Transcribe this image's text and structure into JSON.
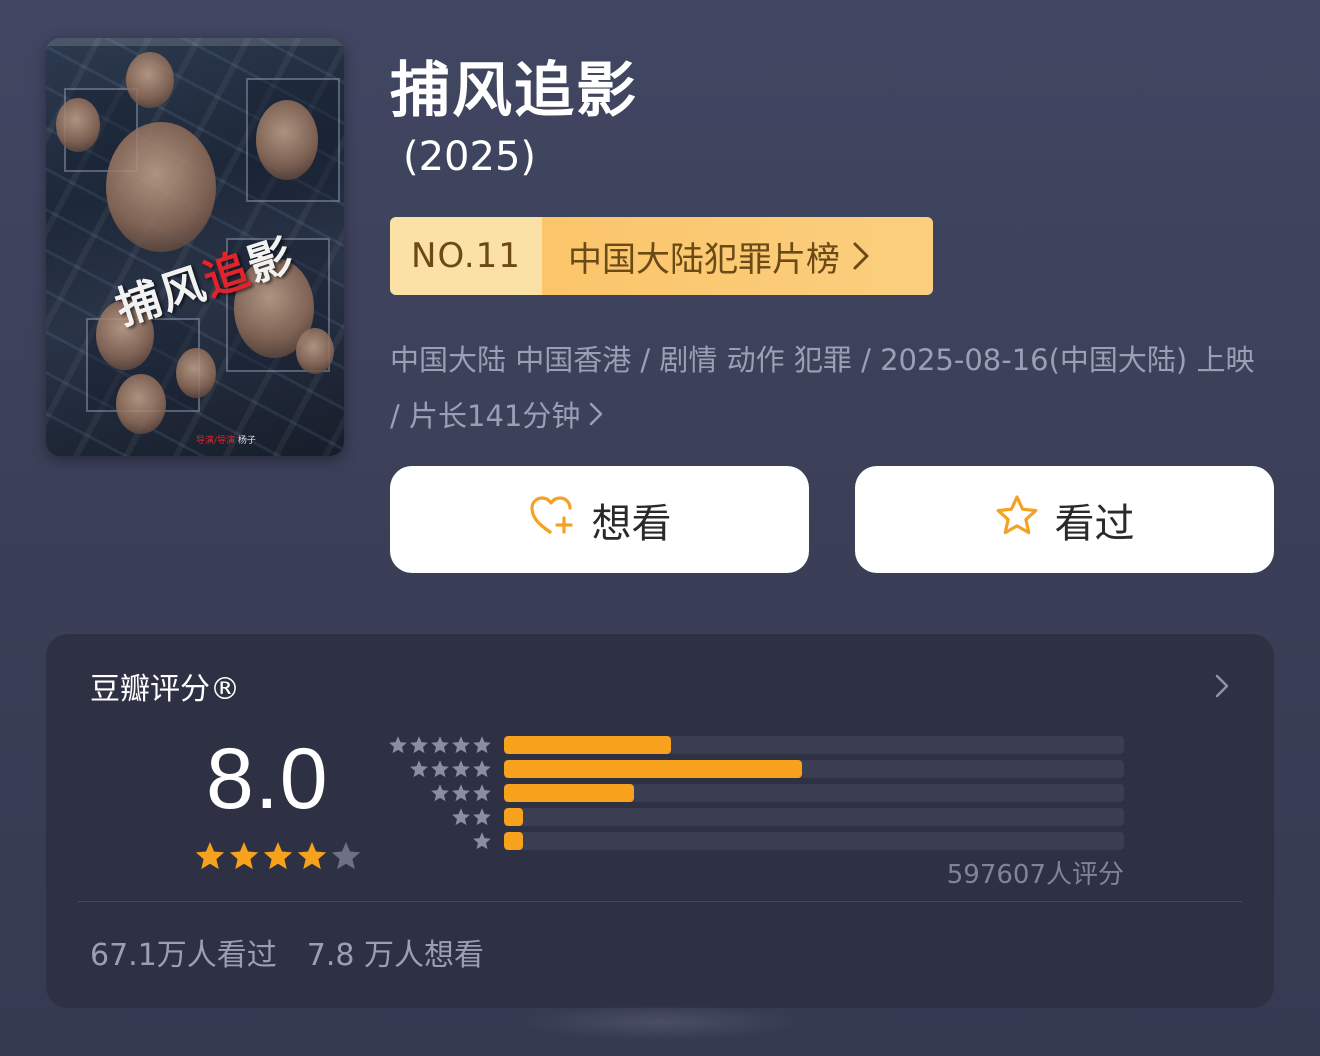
{
  "movie": {
    "title": "捕风追影",
    "year": "(2025)",
    "poster": {
      "title_main": "捕风",
      "title_accent": "追",
      "title_end": "影",
      "credit_role": "导演/导演",
      "credit_name": "杨子"
    }
  },
  "ranking": {
    "number": "NO.11",
    "list_name": "中国大陆犯罪片榜"
  },
  "meta": {
    "text": "中国大陆 中国香港 / 剧情 动作 犯罪 / 2025-08-16(中国大陆) 上映 / 片长141分钟"
  },
  "actions": {
    "want_label": "想看",
    "seen_label": "看过"
  },
  "rating": {
    "title": "豆瓣评分®",
    "score": "8.0",
    "stars": 4,
    "count_text": "597607人评分",
    "distribution": [
      {
        "stars": 5,
        "fraction": 0.27
      },
      {
        "stars": 4,
        "fraction": 0.48
      },
      {
        "stars": 3,
        "fraction": 0.21
      },
      {
        "stars": 2,
        "fraction": 0.03
      },
      {
        "stars": 1,
        "fraction": 0.03
      }
    ],
    "seen_count": "67.1万人看过",
    "want_count": "7.8 万人想看"
  },
  "colors": {
    "accent_orange": "#f7a11c",
    "badge_light": "#fbe1a6",
    "badge_gold": "#fbc56a",
    "badge_text": "#6b4a16",
    "card_bg": "#2e3143"
  }
}
